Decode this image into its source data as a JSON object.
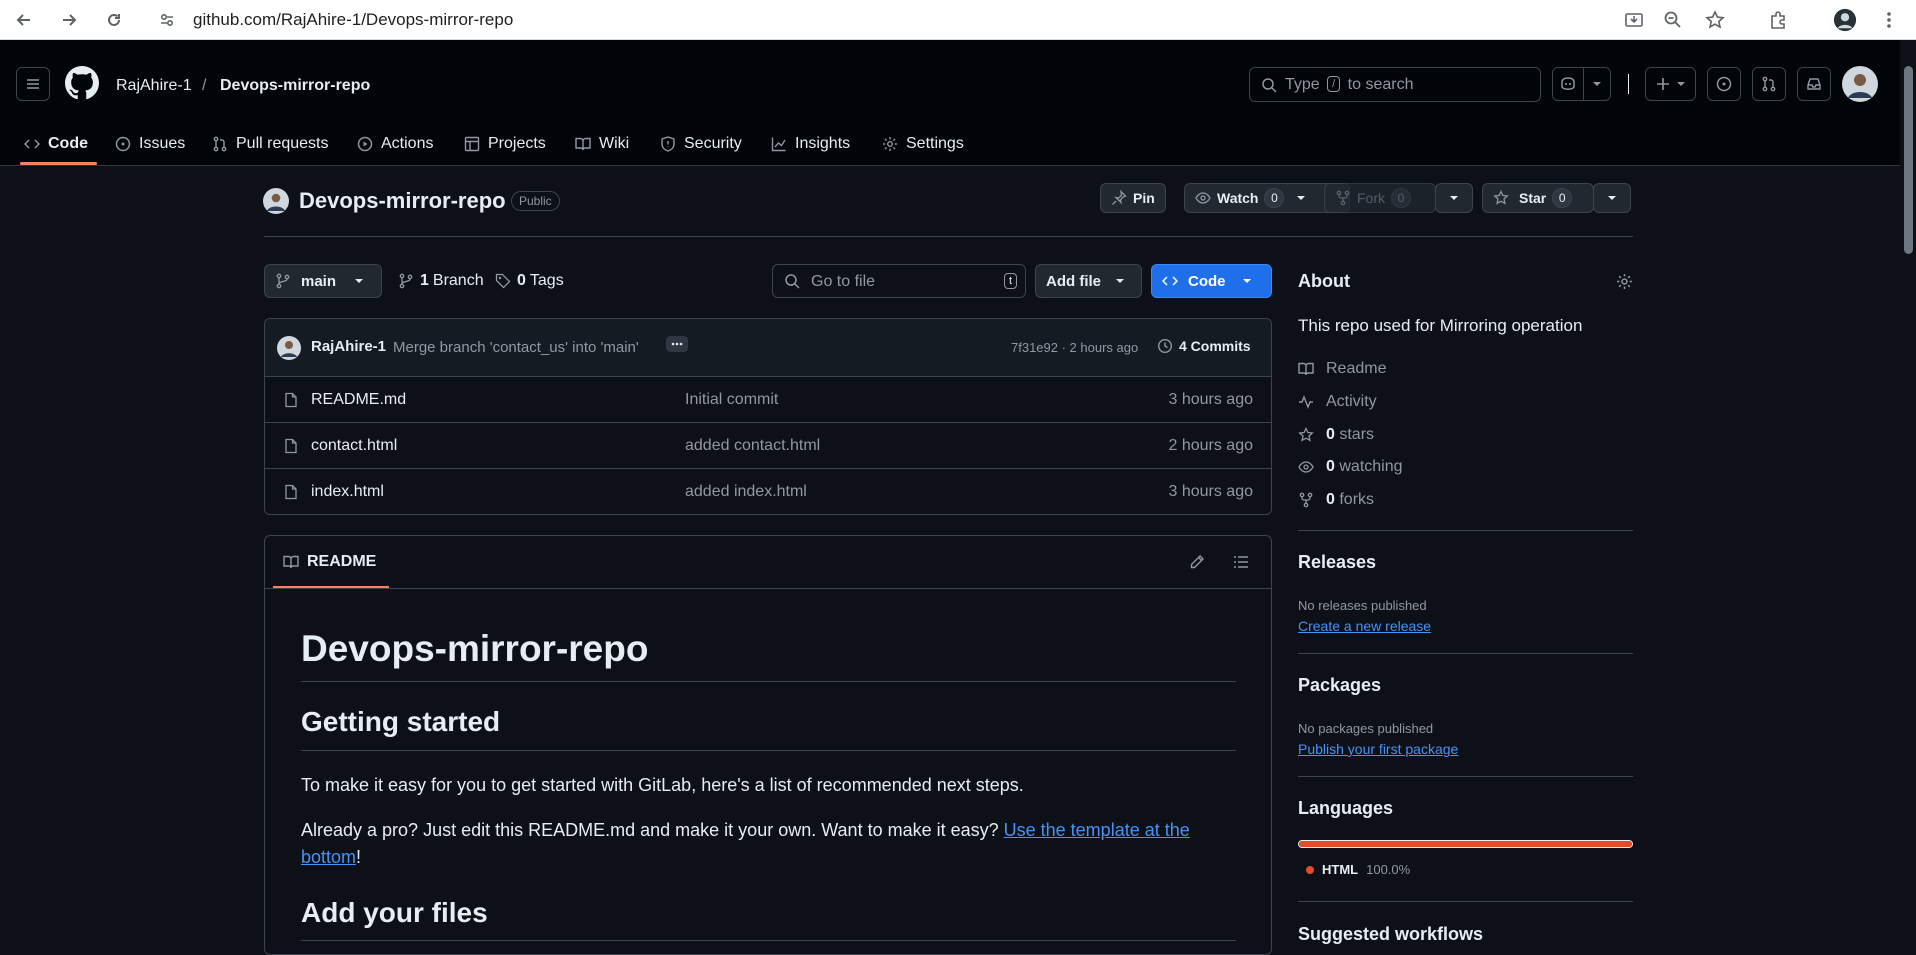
{
  "browser": {
    "url": "github.com/RajAhire-1/Devops-mirror-repo"
  },
  "header": {
    "owner": "RajAhire-1",
    "separator": "/",
    "repo": "Devops-mirror-repo",
    "search_placeholder_pre": "Type",
    "search_key": "/",
    "search_placeholder_post": "to search"
  },
  "tabs": [
    {
      "label": "Code",
      "icon": "code-icon"
    },
    {
      "label": "Issues",
      "icon": "issue-icon"
    },
    {
      "label": "Pull requests",
      "icon": "pull-request-icon"
    },
    {
      "label": "Actions",
      "icon": "play-icon"
    },
    {
      "label": "Projects",
      "icon": "table-icon"
    },
    {
      "label": "Wiki",
      "icon": "book-icon"
    },
    {
      "label": "Security",
      "icon": "shield-icon"
    },
    {
      "label": "Insights",
      "icon": "graph-icon"
    },
    {
      "label": "Settings",
      "icon": "gear-icon"
    }
  ],
  "repo_header": {
    "name": "Devops-mirror-repo",
    "visibility": "Public",
    "pin_label": "Pin",
    "watch_label": "Watch",
    "watch_count": "0",
    "fork_label": "Fork",
    "fork_count": "0",
    "star_label": "Star",
    "star_count": "0"
  },
  "toolbar": {
    "branch": "main",
    "branches_count": "1",
    "branches_label": "Branch",
    "tags_count": "0",
    "tags_label": "Tags",
    "goto_placeholder": "Go to file",
    "goto_key": "t",
    "add_file_label": "Add file",
    "code_label": "Code"
  },
  "latest_commit": {
    "author": "RajAhire-1",
    "message": "Merge branch 'contact_us' into 'main'",
    "meta": "7f31e92 · 2 hours ago",
    "commits_label": "4 Commits"
  },
  "files": [
    {
      "name": "README.md",
      "message": "Initial commit",
      "time": "3 hours ago"
    },
    {
      "name": "contact.html",
      "message": "added contact.html",
      "time": "2 hours ago"
    },
    {
      "name": "index.html",
      "message": "added index.html",
      "time": "3 hours ago"
    }
  ],
  "readme": {
    "tab_label": "README",
    "h1": "Devops-mirror-repo",
    "h2_started": "Getting started",
    "p1": "To make it easy for you to get started with GitLab, here's a list of recommended next steps.",
    "p2_text": "Already a pro? Just edit this README.md and make it your own. Want to make it easy? ",
    "p2_link": "Use the template at the bottom",
    "p2_end": "!",
    "h2_files": "Add your files"
  },
  "about": {
    "title": "About",
    "description": "This repo used for Mirroring operation",
    "readme_label": "Readme",
    "activity_label": "Activity",
    "stars_count": "0",
    "stars_label": "stars",
    "watching_count": "0",
    "watching_label": "watching",
    "forks_count": "0",
    "forks_label": "forks"
  },
  "releases": {
    "title": "Releases",
    "empty": "No releases published",
    "link": "Create a new release"
  },
  "packages": {
    "title": "Packages",
    "empty": "No packages published",
    "link": "Publish your first package"
  },
  "languages": {
    "title": "Languages",
    "items": [
      {
        "name": "HTML",
        "percent": "100.0%",
        "color": "#e34c26"
      }
    ]
  },
  "suggested": {
    "title": "Suggested workflows"
  }
}
